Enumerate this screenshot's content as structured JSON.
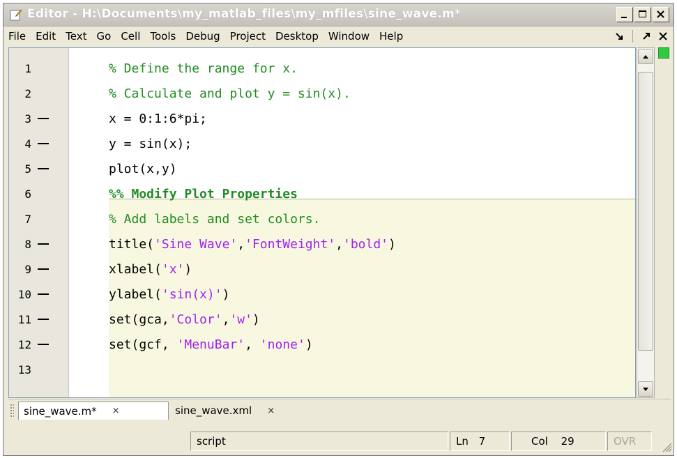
{
  "window": {
    "title": "Editor - H:\\Documents\\my_matlab_files\\my_mfiles\\sine_wave.m*",
    "controls": [
      "minimize",
      "maximize",
      "close"
    ]
  },
  "menubar": {
    "items": [
      "File",
      "Edit",
      "Text",
      "Go",
      "Cell",
      "Tools",
      "Debug",
      "Project",
      "Desktop",
      "Window",
      "Help"
    ]
  },
  "editor": {
    "lines": [
      {
        "num": "1",
        "breakpoint": false,
        "tokens": [
          {
            "t": "% Define the range for x.",
            "k": "comment"
          }
        ]
      },
      {
        "num": "2",
        "breakpoint": false,
        "tokens": [
          {
            "t": "% Calculate and plot y = sin(x).",
            "k": "comment"
          }
        ]
      },
      {
        "num": "3",
        "breakpoint": true,
        "tokens": [
          {
            "t": "x = 0:1:6*pi;",
            "k": "code"
          }
        ]
      },
      {
        "num": "4",
        "breakpoint": true,
        "tokens": [
          {
            "t": "y = sin(x);",
            "k": "code"
          }
        ]
      },
      {
        "num": "5",
        "breakpoint": true,
        "tokens": [
          {
            "t": "plot(x,y)",
            "k": "code"
          }
        ]
      },
      {
        "num": "6",
        "breakpoint": false,
        "tokens": [
          {
            "t": "%% Modify Plot Properties",
            "k": "cell"
          }
        ]
      },
      {
        "num": "7",
        "breakpoint": false,
        "tokens": [
          {
            "t": "% Add labels and set colors.",
            "k": "comment"
          }
        ]
      },
      {
        "num": "8",
        "breakpoint": true,
        "tokens": [
          {
            "t": "title(",
            "k": "code"
          },
          {
            "t": "'Sine Wave'",
            "k": "string"
          },
          {
            "t": ",",
            "k": "code"
          },
          {
            "t": "'FontWeight'",
            "k": "string"
          },
          {
            "t": ",",
            "k": "code"
          },
          {
            "t": "'bold'",
            "k": "string"
          },
          {
            "t": ")",
            "k": "code"
          }
        ]
      },
      {
        "num": "9",
        "breakpoint": true,
        "tokens": [
          {
            "t": "xlabel(",
            "k": "code"
          },
          {
            "t": "'x'",
            "k": "string"
          },
          {
            "t": ")",
            "k": "code"
          }
        ]
      },
      {
        "num": "10",
        "breakpoint": true,
        "tokens": [
          {
            "t": "ylabel(",
            "k": "code"
          },
          {
            "t": "'sin(x)'",
            "k": "string"
          },
          {
            "t": ")",
            "k": "code"
          }
        ]
      },
      {
        "num": "11",
        "breakpoint": true,
        "tokens": [
          {
            "t": "set(gca,",
            "k": "code"
          },
          {
            "t": "'Color'",
            "k": "string"
          },
          {
            "t": ",",
            "k": "code"
          },
          {
            "t": "'w'",
            "k": "string"
          },
          {
            "t": ")",
            "k": "code"
          }
        ]
      },
      {
        "num": "12",
        "breakpoint": true,
        "tokens": [
          {
            "t": "set(gcf, ",
            "k": "code"
          },
          {
            "t": "'MenuBar'",
            "k": "string"
          },
          {
            "t": ", ",
            "k": "code"
          },
          {
            "t": "'none'",
            "k": "string"
          },
          {
            "t": ")",
            "k": "code"
          }
        ]
      },
      {
        "num": "13",
        "breakpoint": false,
        "tokens": []
      }
    ]
  },
  "tabs": [
    {
      "label": "sine_wave.m*",
      "active": true,
      "close": "×"
    },
    {
      "label": "sine_wave.xml",
      "active": false,
      "close": "×"
    }
  ],
  "statusbar": {
    "mode": "script",
    "ln_label": "Ln",
    "ln_value": "7",
    "col_label": "Col",
    "col_value": "29",
    "ovr": "OVR"
  },
  "colors": {
    "comment": "#228b22",
    "string": "#a020f0",
    "cell_background": "#f8f8e0",
    "status_indicator": "#2ecc40"
  }
}
